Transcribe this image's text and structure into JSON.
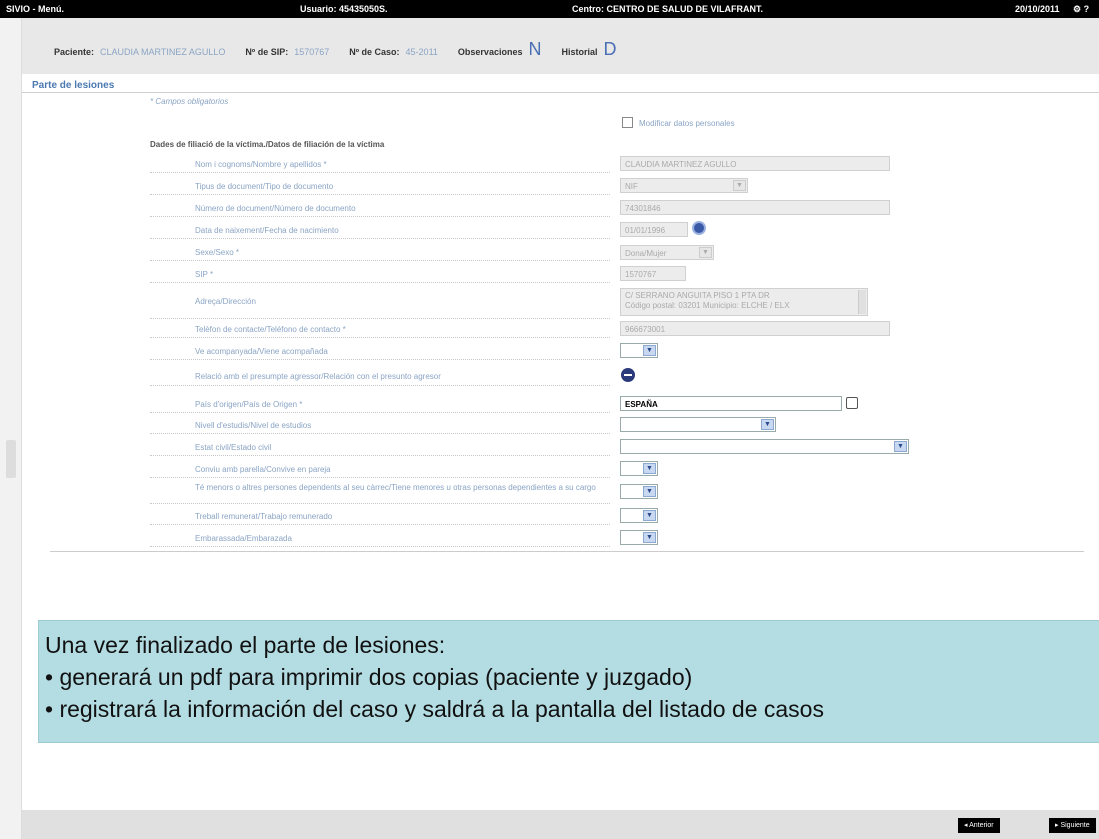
{
  "topbar": {
    "menu": "SIVIO - Menú.",
    "user": "Usuario: 45435050S.",
    "center": "Centro: CENTRO DE SALUD DE VILAFRANT.",
    "date": "20/10/2011",
    "icons": "⚙ ?"
  },
  "patient": {
    "label_patient": "Paciente:",
    "patient_name": "CLAUDIA MARTINEZ AGULLO",
    "label_sip": "Nº de SIP:",
    "sip": "1570767",
    "label_case": "Nº de Caso:",
    "case": "45-2011",
    "label_obs": "Observaciones",
    "obs_value": "N",
    "label_hist": "Historial",
    "hist_value": "D"
  },
  "section": {
    "title": "Parte de lesiones",
    "required_note": "* Campos obligatorios",
    "modify_label": "Modificar datos personales",
    "group_title": "Dades de filiació de la víctima./Datos de filiación de la víctima"
  },
  "fields": [
    {
      "label": "Nom i cognoms/Nombre y apellidos *",
      "value": "CLAUDIA MARTINEZ AGULLO"
    },
    {
      "label": "Tipus de document/Tipo de documento",
      "value": "NIF"
    },
    {
      "label": "Número de document/Número de documento",
      "value": "74301846"
    },
    {
      "label": "Data de naixement/Fecha de nacimiento",
      "value": "01/01/1996"
    },
    {
      "label": "Sexe/Sexo *",
      "value": "Dona/Mujer"
    },
    {
      "label": "SIP *",
      "value": "1570767"
    },
    {
      "label": "Adreça/Dirección",
      "value_line1": "C/ SERRANO ANGUITA PISO 1 PTA DR",
      "value_line2": "Código postal: 03201 Municipio: ELCHE / ELX"
    },
    {
      "label": "Telèfon de contacte/Teléfono de contacto *",
      "value": "966673001"
    },
    {
      "label": "Ve acompanyada/Viene acompañada",
      "value": ""
    },
    {
      "label": "Relació amb el presumpte agressor/Relación con el presunto agresor",
      "value": ""
    },
    {
      "label": "País d'origen/País de Origen *",
      "value": "ESPAÑA"
    },
    {
      "label": "Nivell d'estudis/Nivel de estudios",
      "value": ""
    },
    {
      "label": "Estat civil/Estado civil",
      "value": ""
    },
    {
      "label": "Conviu amb parella/Convive en pareja",
      "value": ""
    },
    {
      "label": "Té menors o altres persones dependents al seu càrrec/Tiene menores u otras personas dependientes a su cargo",
      "value": ""
    },
    {
      "label": "Treball remunerat/Trabajo remunerado",
      "value": ""
    },
    {
      "label": "Embarassada/Embarazada",
      "value": ""
    }
  ],
  "callout": {
    "line1": "Una vez finalizado el parte de lesiones:",
    "line2": "• generará un pdf para imprimir dos copias (paciente y juzgado)",
    "line3": "• registrará la información del caso y saldrá a la pantalla del listado de casos"
  },
  "nav": {
    "prev": "◂ Anterior",
    "next": "▸ Siguiente"
  }
}
